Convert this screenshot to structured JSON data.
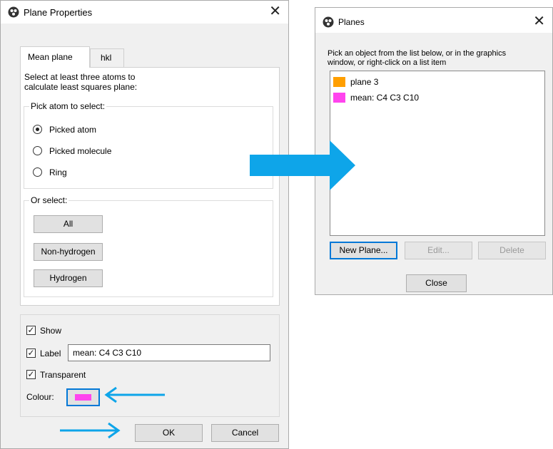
{
  "plane_properties": {
    "title": "Plane Properties",
    "tabs": [
      "Mean plane",
      "hkl"
    ],
    "instruction": [
      "Select at least three atoms to",
      "calculate least squares plane:"
    ],
    "pick_group_label": "Pick atom to select:",
    "pick_options": [
      {
        "label": "Picked atom",
        "selected": true
      },
      {
        "label": "Picked molecule",
        "selected": false
      },
      {
        "label": "Ring",
        "selected": false
      }
    ],
    "or_select_label": "Or select:",
    "select_buttons": [
      "All",
      "Non-hydrogen",
      "Hydrogen"
    ],
    "show_label": "Show",
    "show_checked": true,
    "label_label": "Label",
    "label_checked": true,
    "label_value": "mean: C4 C3 C10",
    "transparent_label": "Transparent",
    "transparent_checked": true,
    "colour_label": "Colour:",
    "colour_value": "#ff44ee",
    "ok_label": "OK",
    "cancel_label": "Cancel"
  },
  "planes": {
    "title": "Planes",
    "instruction": [
      "Pick an object from the list below, or in the graphics",
      "window, or right-click on a list item"
    ],
    "items": [
      {
        "label": "plane 3",
        "color": "#ff9f00"
      },
      {
        "label": "mean: C4 C3 C10",
        "color": "#ff44ee"
      }
    ],
    "new_plane_label": "New Plane...",
    "edit_label": "Edit...",
    "delete_label": "Delete",
    "close_label": "Close"
  },
  "annotation_color": "#0ea5e9"
}
